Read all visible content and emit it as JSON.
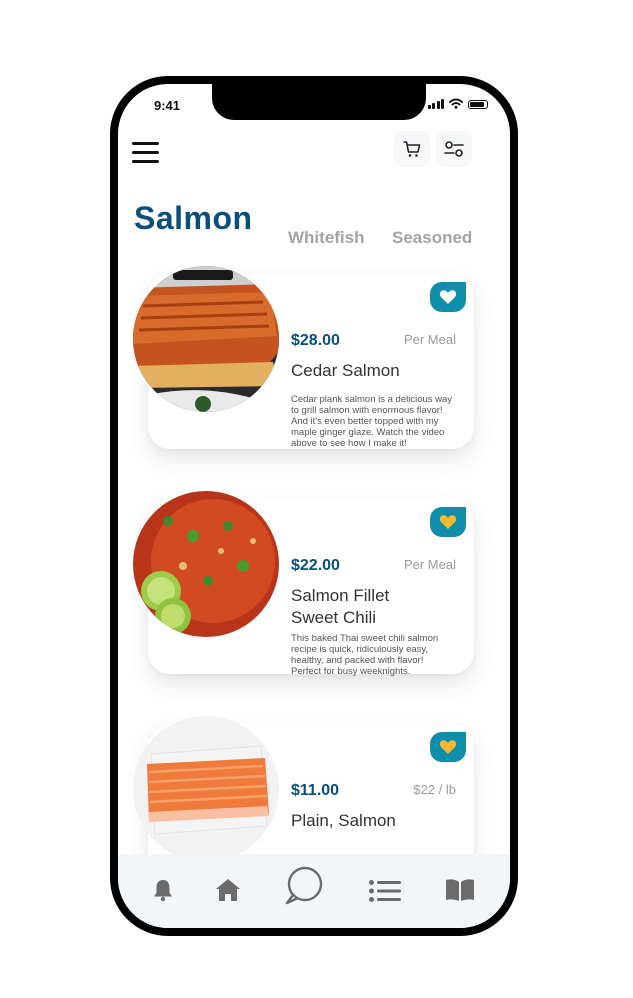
{
  "status": {
    "time": "9:41"
  },
  "tabs": [
    {
      "label": "Salmon",
      "active": true
    },
    {
      "label": "Whitefish",
      "active": false
    },
    {
      "label": "Seasoned",
      "active": false
    }
  ],
  "items": [
    {
      "price": "$28.00",
      "unit": "Per Meal",
      "name": "Cedar Salmon",
      "description": "Cedar plank salmon is a delicious way to grill salmon with enormous flavor! And it's even better topped with my maple ginger glaze. Watch the video above to see how I make it!",
      "favorite_icon": "heart-icon",
      "heart_color": "#ffffff"
    },
    {
      "price": "$22.00",
      "unit": "Per Meal",
      "name": "Salmon Fillet Sweet Chili",
      "description": "This baked Thai sweet chili salmon recipe is quick, ridiculously easy, healthy, and packed with flavor! Perfect for busy weeknights.",
      "favorite_icon": "heart-icon",
      "heart_color": "#f5b82e"
    },
    {
      "price": "$11.00",
      "unit": "$22 / lb",
      "name": "Plain, Salmon",
      "description": "",
      "favorite_icon": "heart-icon",
      "heart_color": "#f5b82e"
    }
  ],
  "nav": [
    "bell-icon",
    "home-icon",
    "chat-icon",
    "list-icon",
    "book-icon"
  ],
  "colors": {
    "brand": "#0a4e7c",
    "accent": "#0f8eab",
    "favorite": "#f5b82e",
    "nav": "#6b6b6b"
  }
}
